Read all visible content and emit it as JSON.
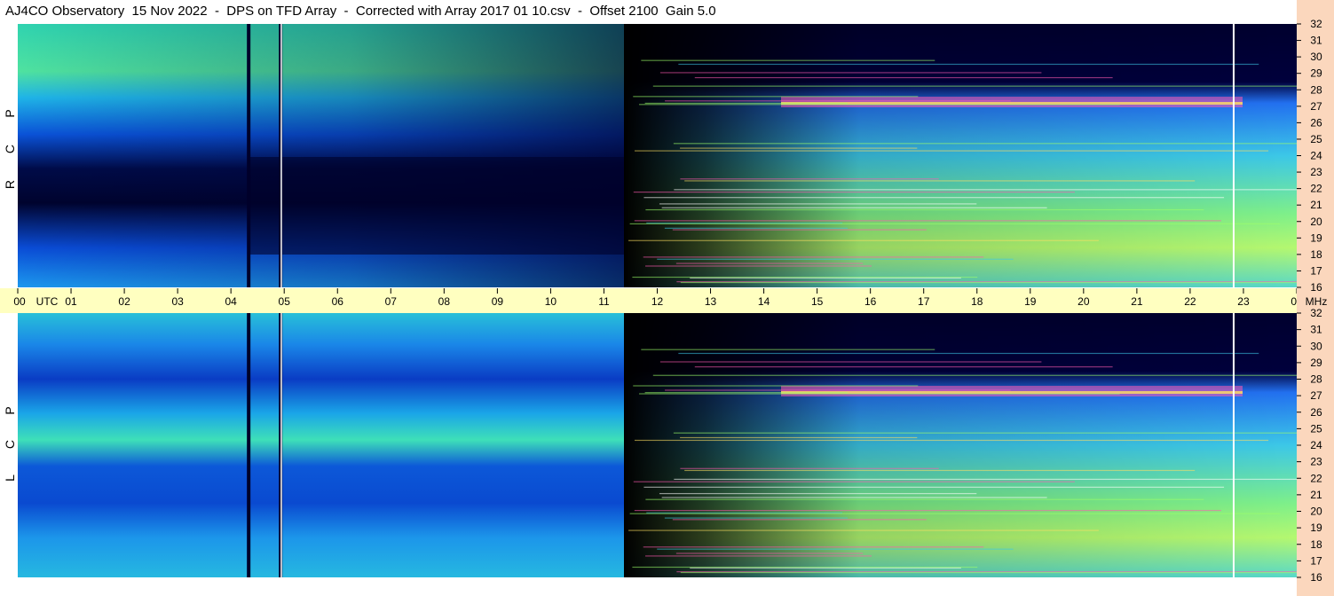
{
  "title": "AJ4CO Observatory  15 Nov 2022  -  DPS on TFD Array  -  Corrected with Array 2017 01 10.csv  -  Offset 2100  Gain 5.0",
  "polarizations": {
    "rcp": [
      "R",
      "C",
      "P"
    ],
    "lcp": [
      "L",
      "C",
      "P"
    ]
  },
  "colors": {
    "background": "#ffffff",
    "utc_band": "#ffffc0",
    "freq_column": "#fbd7bd",
    "low_intensity": "#00003a",
    "mid_intensity": "#1e90ff",
    "high_intensity": "#9cff6a",
    "peak_intensity": "#ff40a0"
  },
  "chart_data": {
    "type": "heatmap",
    "title": "AJ4CO Observatory  15 Nov 2022  -  DPS on TFD Array  -  Corrected with Array 2017 01 10.csv  -  Offset 2100  Gain 5.0",
    "x_axis": {
      "label": "UTC",
      "range": [
        0,
        24
      ],
      "tick_labels": [
        "00",
        "01",
        "02",
        "03",
        "04",
        "05",
        "06",
        "07",
        "08",
        "09",
        "10",
        "11",
        "12",
        "13",
        "14",
        "15",
        "16",
        "17",
        "18",
        "19",
        "20",
        "21",
        "22",
        "23",
        "00"
      ]
    },
    "y_axis": {
      "label": "MHz",
      "range": [
        16,
        32
      ],
      "tick_labels": [
        "16",
        "17",
        "18",
        "19",
        "20",
        "21",
        "22",
        "23",
        "24",
        "25",
        "26",
        "27",
        "28",
        "29",
        "30",
        "31",
        "32"
      ]
    },
    "panels": [
      {
        "name": "RCP",
        "label": "R C P"
      },
      {
        "name": "LCP",
        "label": "L C P"
      }
    ],
    "features": {
      "night_to_day_transition_utc": 11.4,
      "bright_broadband_start_utc": 13.0,
      "vertical_gap_lines_utc": [
        4.3,
        4.9,
        22.8
      ],
      "strong_interference_band_mhz": 27.2
    }
  }
}
